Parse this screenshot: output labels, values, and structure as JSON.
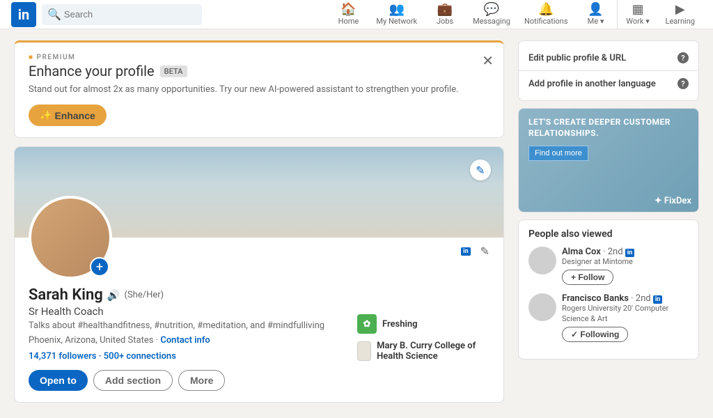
{
  "nav": {
    "search_placeholder": "Search",
    "items": [
      "Home",
      "My Network",
      "Jobs",
      "Messaging",
      "Notifications",
      "Me ▾",
      "Work ▾",
      "Learning"
    ]
  },
  "premium": {
    "label": "PREMIUM",
    "title": "Enhance your profile",
    "badge": "BETA",
    "desc": "Stand out for almost 2x as many opportunities. Try our new AI-powered assistant to strengthen your profile.",
    "button": "Enhance"
  },
  "profile": {
    "name": "Sarah King",
    "pronouns": "(She/Her)",
    "title": "Sr Health Coach",
    "talks": "Talks about #healthandfitness, #nutrition, #meditation, and #mindfulliving",
    "location": "Phoenix, Arizona, United States",
    "contact": "Contact info",
    "followers": "14,371 followers",
    "connections": "500+ connections",
    "actions": {
      "open": "Open to",
      "add": "Add section",
      "more": "More"
    },
    "org1": "Freshing",
    "org2": "Mary B. Curry College of Health Science"
  },
  "rightlinks": {
    "edit_public": "Edit public profile & URL",
    "add_lang": "Add profile in another language"
  },
  "ad": {
    "headline": "LET'S CREATE DEEPER CUSTOMER RELATIONSHIPS.",
    "cta": "Find out more",
    "brand": "FixDex"
  },
  "pav": {
    "title": "People also viewed",
    "items": [
      {
        "name": "Alma Cox",
        "degree": "· 2nd",
        "sub": "Designer at Mintome",
        "btn": "+ Follow"
      },
      {
        "name": "Francisco Banks",
        "degree": "· 2nd",
        "sub": "Rogers University 20' Computer Science & Art",
        "btn": "✓ Following"
      }
    ]
  }
}
